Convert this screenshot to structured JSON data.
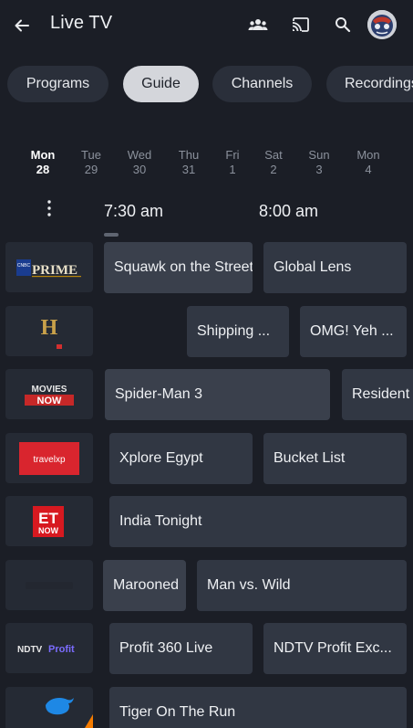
{
  "header": {
    "title": "Live TV",
    "icons": [
      "back-arrow-icon",
      "people-icon",
      "cast-icon",
      "search-icon",
      "avatar"
    ]
  },
  "tabs": [
    {
      "label": "Programs",
      "active": false
    },
    {
      "label": "Guide",
      "active": true
    },
    {
      "label": "Channels",
      "active": false
    },
    {
      "label": "Recordings",
      "active": false
    }
  ],
  "days": [
    {
      "dow": "Mon",
      "date": "28",
      "active": true
    },
    {
      "dow": "Tue",
      "date": "29",
      "active": false
    },
    {
      "dow": "Wed",
      "date": "30",
      "active": false
    },
    {
      "dow": "Thu",
      "date": "31",
      "active": false
    },
    {
      "dow": "Fri",
      "date": "1",
      "active": false
    },
    {
      "dow": "Sat",
      "date": "2",
      "active": false
    },
    {
      "dow": "Sun",
      "date": "3",
      "active": false
    },
    {
      "dow": "Mon",
      "date": "4",
      "active": false
    }
  ],
  "times": [
    "7:30 am",
    "8:00 am"
  ],
  "guide": [
    {
      "channel": "CNBC TV18 Prime",
      "logo": {
        "lines": [
          "CNBC",
          "PRIME"
        ]
      },
      "programs": [
        "Squawk on the Street",
        "Global Lens"
      ]
    },
    {
      "channel": "History TV18",
      "logo": {
        "lines": [
          "H"
        ]
      },
      "programs": [
        "Shipping ...",
        "OMG! Yeh ..."
      ]
    },
    {
      "channel": "Movies Now",
      "logo": {
        "lines": [
          "MOVIES",
          "NOW"
        ]
      },
      "programs": [
        "Spider-Man 3",
        "Resident Evil"
      ]
    },
    {
      "channel": "Travelxp",
      "logo": {
        "lines": [
          "travelxp"
        ]
      },
      "programs": [
        "Xplore Egypt",
        "Bucket List"
      ]
    },
    {
      "channel": "ET Now",
      "logo": {
        "lines": [
          "ET",
          "NOW"
        ]
      },
      "programs": [
        "India Tonight"
      ]
    },
    {
      "channel": "Nat Geo Wild",
      "logo": {
        "lines": [
          ""
        ]
      },
      "programs": [
        "Marooned",
        "Man vs. Wild"
      ]
    },
    {
      "channel": "NDTV Profit",
      "logo": {
        "lines": [
          "NDTV",
          "Profit"
        ]
      },
      "programs": [
        "Profit 360 Live",
        "NDTV Profit Exc..."
      ]
    },
    {
      "channel": "Animal Planet",
      "logo": {
        "lines": [
          ""
        ]
      },
      "programs": [
        "Tiger On The Run"
      ]
    }
  ]
}
